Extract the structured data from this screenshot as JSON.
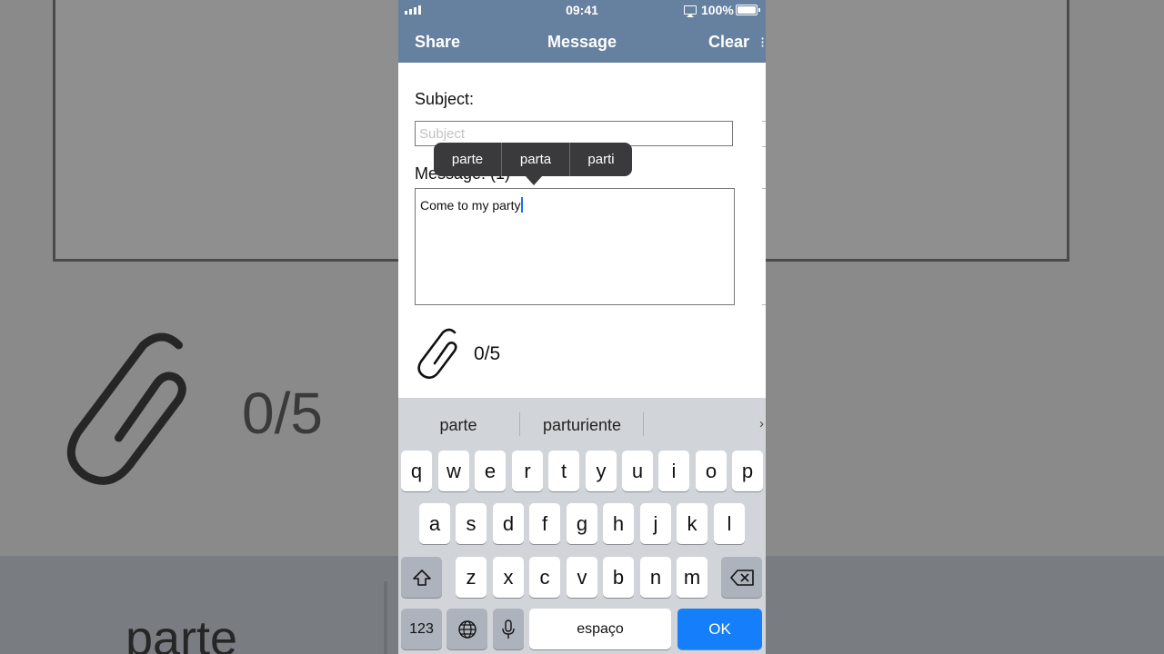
{
  "status_bar": {
    "time": "09:41",
    "battery": "100%"
  },
  "nav": {
    "left": "Share",
    "title": "Message",
    "right": "Clear"
  },
  "form": {
    "subject_label": "Subject:",
    "subject_placeholder": "Subject",
    "message_label": "Message: (1)",
    "message_text": "Come to my party"
  },
  "autocorrect_popup": [
    "parte",
    "parta",
    "parti"
  ],
  "attachments": {
    "count": "0/5"
  },
  "keyboard": {
    "suggestions": [
      "parte",
      "parturiente"
    ],
    "row1": [
      "q",
      "w",
      "e",
      "r",
      "t",
      "y",
      "u",
      "i",
      "o",
      "p"
    ],
    "row2": [
      "a",
      "s",
      "d",
      "f",
      "g",
      "h",
      "j",
      "k",
      "l"
    ],
    "row3": [
      "z",
      "x",
      "c",
      "v",
      "b",
      "n",
      "m"
    ],
    "numbers_key": "123",
    "space_key": "espaço",
    "return_key": "OK",
    "shift_icon": "shift-arrow-icon",
    "delete_icon": "backspace-icon",
    "globe_icon": "globe-icon",
    "mic_icon": "microphone-icon"
  },
  "background": {
    "count": "0/5",
    "word": "parte"
  }
}
